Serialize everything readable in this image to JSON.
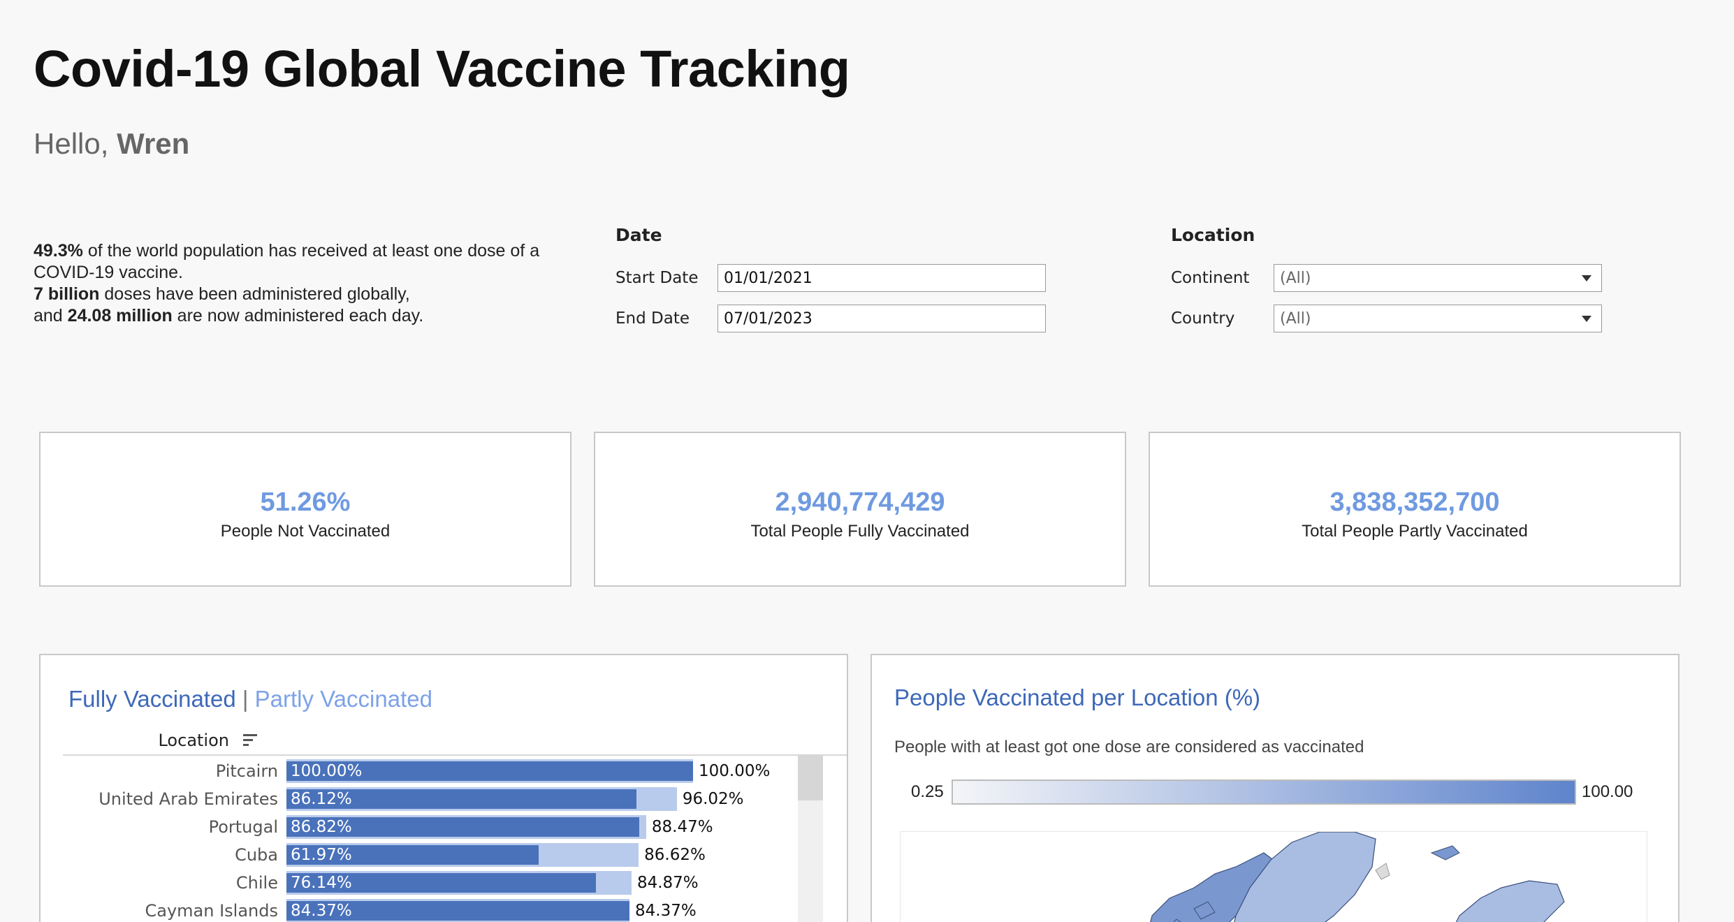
{
  "header": {
    "title": "Covid-19 Global Vaccine Tracking",
    "greeting": "Hello,",
    "user_name": "Wren"
  },
  "summary": {
    "pct": "49.3%",
    "line1": " of the world population has received at least one dose of a COVID-19 vaccine.",
    "doses": "7 billion",
    "line2": " doses have been administered globally,",
    "line3_pre": "and ",
    "daily": "24.08 million",
    "line3_post": " are now administered each day."
  },
  "date_filter": {
    "title": "Date",
    "start_label": "Start Date",
    "start_value": "01/01/2021",
    "end_label": "End Date",
    "end_value": "07/01/2023"
  },
  "location_filter": {
    "title": "Location",
    "continent_label": "Continent",
    "continent_value": "(All)",
    "country_label": "Country",
    "country_value": "(All)"
  },
  "kpis": [
    {
      "value": "51.26%",
      "label": "People Not Vaccinated"
    },
    {
      "value": "2,940,774,429",
      "label": "Total People Fully Vaccinated"
    },
    {
      "value": "3,838,352,700",
      "label": "Total People Partly Vaccinated"
    }
  ],
  "bar_panel": {
    "title_fully": "Fully Vaccinated",
    "separator": "|",
    "title_partly": "Partly Vaccinated",
    "location_header": "Location",
    "colors": {
      "fully": "#4a72bb",
      "partly": "#b9cbec"
    }
  },
  "chart_data": {
    "type": "bar",
    "categories": [
      "Pitcairn",
      "United Arab Emirates",
      "Portugal",
      "Cuba",
      "Chile",
      "Cayman Islands"
    ],
    "series": [
      {
        "name": "Fully Vaccinated",
        "values": [
          100.0,
          86.12,
          86.82,
          61.97,
          76.14,
          84.37
        ],
        "labels": [
          "100.00%",
          "86.12%",
          "86.82%",
          "61.97%",
          "76.14%",
          "84.37%"
        ]
      },
      {
        "name": "Partly Vaccinated",
        "values": [
          100.0,
          96.02,
          88.47,
          86.62,
          84.87,
          84.37
        ],
        "labels": [
          "100.00%",
          "96.02%",
          "88.47%",
          "86.62%",
          "84.87%",
          "84.37%"
        ]
      }
    ],
    "xlim": [
      0,
      100
    ]
  },
  "map_panel": {
    "title": "People Vaccinated per Location (%)",
    "subtitle": "People with at least got one dose are considered as vaccinated",
    "legend_min": "0.25",
    "legend_max": "100.00",
    "colors": {
      "low": "#f4f5f8",
      "high": "#5f84cc"
    }
  }
}
